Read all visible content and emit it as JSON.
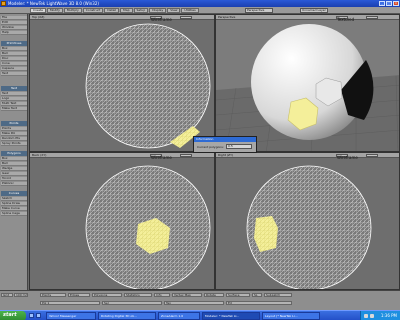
{
  "window": {
    "title": "Modeler: * NewTek LightWave 3D 8.0 (Win32)"
  },
  "toolbar": {
    "tabs": [
      "Create",
      "Modify",
      "Multiply",
      "Construct",
      "Detail",
      "Map",
      "Setup",
      "Display",
      "View",
      "Utilities"
    ],
    "viewport_dropdown": "Perspective",
    "layer_dropdown": "Unnamed Layer"
  },
  "leftpanel": {
    "top_items": [
      "File",
      "Edit",
      "Window",
      "Help"
    ],
    "sections": [
      {
        "title": "Primitives",
        "items": [
          "Box",
          "Ball",
          "Disc",
          "Cone",
          "Capsule",
          "Text"
        ]
      },
      {
        "title": "Text",
        "items": [
          "Text",
          "Logo",
          "Multi Text",
          "Make Text"
        ]
      },
      {
        "title": "Points",
        "items": [
          "Points",
          "Make Pol",
          "Random Pts",
          "Spray Points"
        ]
      },
      {
        "title": "Polygons",
        "items": [
          "Box",
          "Ball",
          "Wedge",
          "Gear",
          "Toroid",
          "Platonic"
        ]
      },
      {
        "title": "Curves",
        "items": [
          "Sketch",
          "Spline Draw",
          "Make Curve",
          "Spline Cage"
        ]
      }
    ]
  },
  "viewports": [
    {
      "caption": "Top (XZ)",
      "mode": "Wireframe"
    },
    {
      "caption": "Perspective",
      "mode": "Textured"
    },
    {
      "caption": "Back (XY)",
      "mode": "Wireframe"
    },
    {
      "caption": "Right (ZY)",
      "mode": "Wireframe"
    }
  ],
  "dialog": {
    "title": "Information",
    "label": "Current polygons:",
    "value": "0.5"
  },
  "bottombar": {
    "left_labels": [
      "Grid",
      "100 mm"
    ],
    "modes": [
      "Points",
      "Edges",
      "Polygons",
      "Statistics",
      "Info",
      "Vertex Map",
      "Rotate",
      "Surface",
      "SL",
      "Subpatch"
    ],
    "cells": [
      "Pol 1",
      "Sel",
      "Tex",
      "Ed"
    ]
  },
  "taskbar": {
    "start_label": "start",
    "tasks": [
      "Yahoo! Messenger",
      "Rotating Digital 3D ob...",
      "ZoneAlarm 1.0",
      "Modeler: * NewTek LI...",
      "Layout (* NewTek Li..."
    ],
    "active_task": 3,
    "clock": "1:36 PM"
  },
  "colors": {
    "mesh_white": "#ffffff",
    "selection_yellow": "#f4ef9a",
    "viewport_bg": "#6e6e6e"
  }
}
